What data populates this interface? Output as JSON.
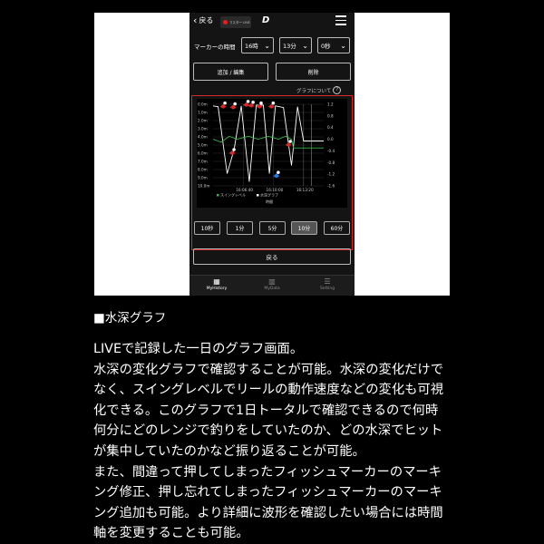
{
  "header": {
    "back_label": "戻る",
    "live_badge": "マスター LIVE",
    "logo": "D"
  },
  "marker_time": {
    "label": "マーカーの時間",
    "hour": "16時",
    "minute": "13分",
    "second": "0秒"
  },
  "actions": {
    "add_edit": "追加 / 編集",
    "delete": "削除"
  },
  "graph_info_label": "グラフについて",
  "chart_data": {
    "type": "line",
    "left_axis": {
      "labels": [
        "0.0m",
        "1.0m",
        "2.0m",
        "3.0m",
        "4.0m",
        "5.0m",
        "6.0m",
        "7.0m",
        "8.0m",
        "9.0m",
        "10.0m"
      ],
      "range": [
        0,
        10
      ],
      "inverted": true
    },
    "right_axis": {
      "labels": [
        "1.2",
        "0.8",
        "0.4",
        "0.0",
        "-0.4",
        "-0.8",
        "-1.2",
        "-1.6"
      ],
      "range": [
        -1.6,
        1.2
      ]
    },
    "x_ticks": [
      "16:06:40",
      "16:10:00",
      "16:13:20"
    ],
    "xlabel": "時間",
    "legend": [
      "スイングレベル",
      "水深グラフ"
    ],
    "series": [
      {
        "name": "水深グラフ",
        "color": "#ffffff",
        "x": [
          0,
          0.5,
          1.4,
          2.1,
          2.8,
          3.6,
          4.3,
          5.0,
          5.6,
          6.2,
          7.0,
          7.8,
          8.4,
          9.0,
          10.0,
          11.0
        ],
        "y": [
          0.2,
          0.3,
          8.5,
          5.5,
          0.2,
          9.5,
          0.1,
          0.1,
          8.5,
          0.2,
          0.4,
          7.5,
          0.3,
          4.5,
          4.5,
          4.5
        ]
      },
      {
        "name": "スイングレベル",
        "color": "#3cb44b",
        "x": [
          0,
          0.8,
          1.6,
          2.4,
          3.5,
          4.5,
          5.5,
          6.5,
          7.2,
          7.8,
          8.0,
          8.5,
          9.5,
          11.0
        ],
        "y": [
          0.0,
          -0.1,
          0.1,
          0.0,
          0.1,
          0.0,
          0.1,
          0.0,
          0.1,
          0.0,
          -0.3,
          -0.3,
          -0.3,
          -0.3
        ]
      }
    ],
    "markers": [
      {
        "x": 1.0,
        "y": 0.3,
        "color": "red"
      },
      {
        "x": 2.0,
        "y": 0.4,
        "color": "red"
      },
      {
        "x": 3.3,
        "y": 0.1,
        "color": "red"
      },
      {
        "x": 3.8,
        "y": 0.2,
        "color": "red"
      },
      {
        "x": 4.6,
        "y": 0.3,
        "color": "red"
      },
      {
        "x": 5.8,
        "y": 0.3,
        "color": "red"
      },
      {
        "x": 1.9,
        "y": 6.0,
        "color": "red"
      },
      {
        "x": 7.5,
        "y": 5.0,
        "color": "red"
      },
      {
        "x": 6.3,
        "y": 8.8,
        "color": "blue"
      }
    ]
  },
  "zoom_options": [
    "10秒",
    "1分",
    "5分",
    "10分",
    "60分"
  ],
  "zoom_selected_index": 3,
  "return_label": "戻る",
  "bottom_nav": [
    {
      "icon": "calendar-icon",
      "label": "MyHistory"
    },
    {
      "icon": "bar-chart-icon",
      "label": "MyData"
    },
    {
      "icon": "settings-icon",
      "label": "Setting"
    }
  ],
  "caption": {
    "heading": "■水深グラフ",
    "lines": [
      "LIVEで記録した一日のグラフ画面。",
      "水深の変化グラフで確認することが可能。水深の変化だけで",
      "なく、スイングレベルでリールの動作速度などの変化も可視",
      "化できる。このグラフで1日トータルで確認できるので何時",
      "何分にどのレンジで釣りをしていたのか、どの水深でヒット",
      "が集中していたのかなど振り返ることが可能。",
      "また、間違って押してしまったフィッシュマーカーのマーキ",
      "ング修正、押し忘れてしまったフィッシュマーカーのマーキ",
      "ング追加も可能。より詳細に波形を確認したい場合には時間",
      "軸を変更することも可能。"
    ]
  }
}
